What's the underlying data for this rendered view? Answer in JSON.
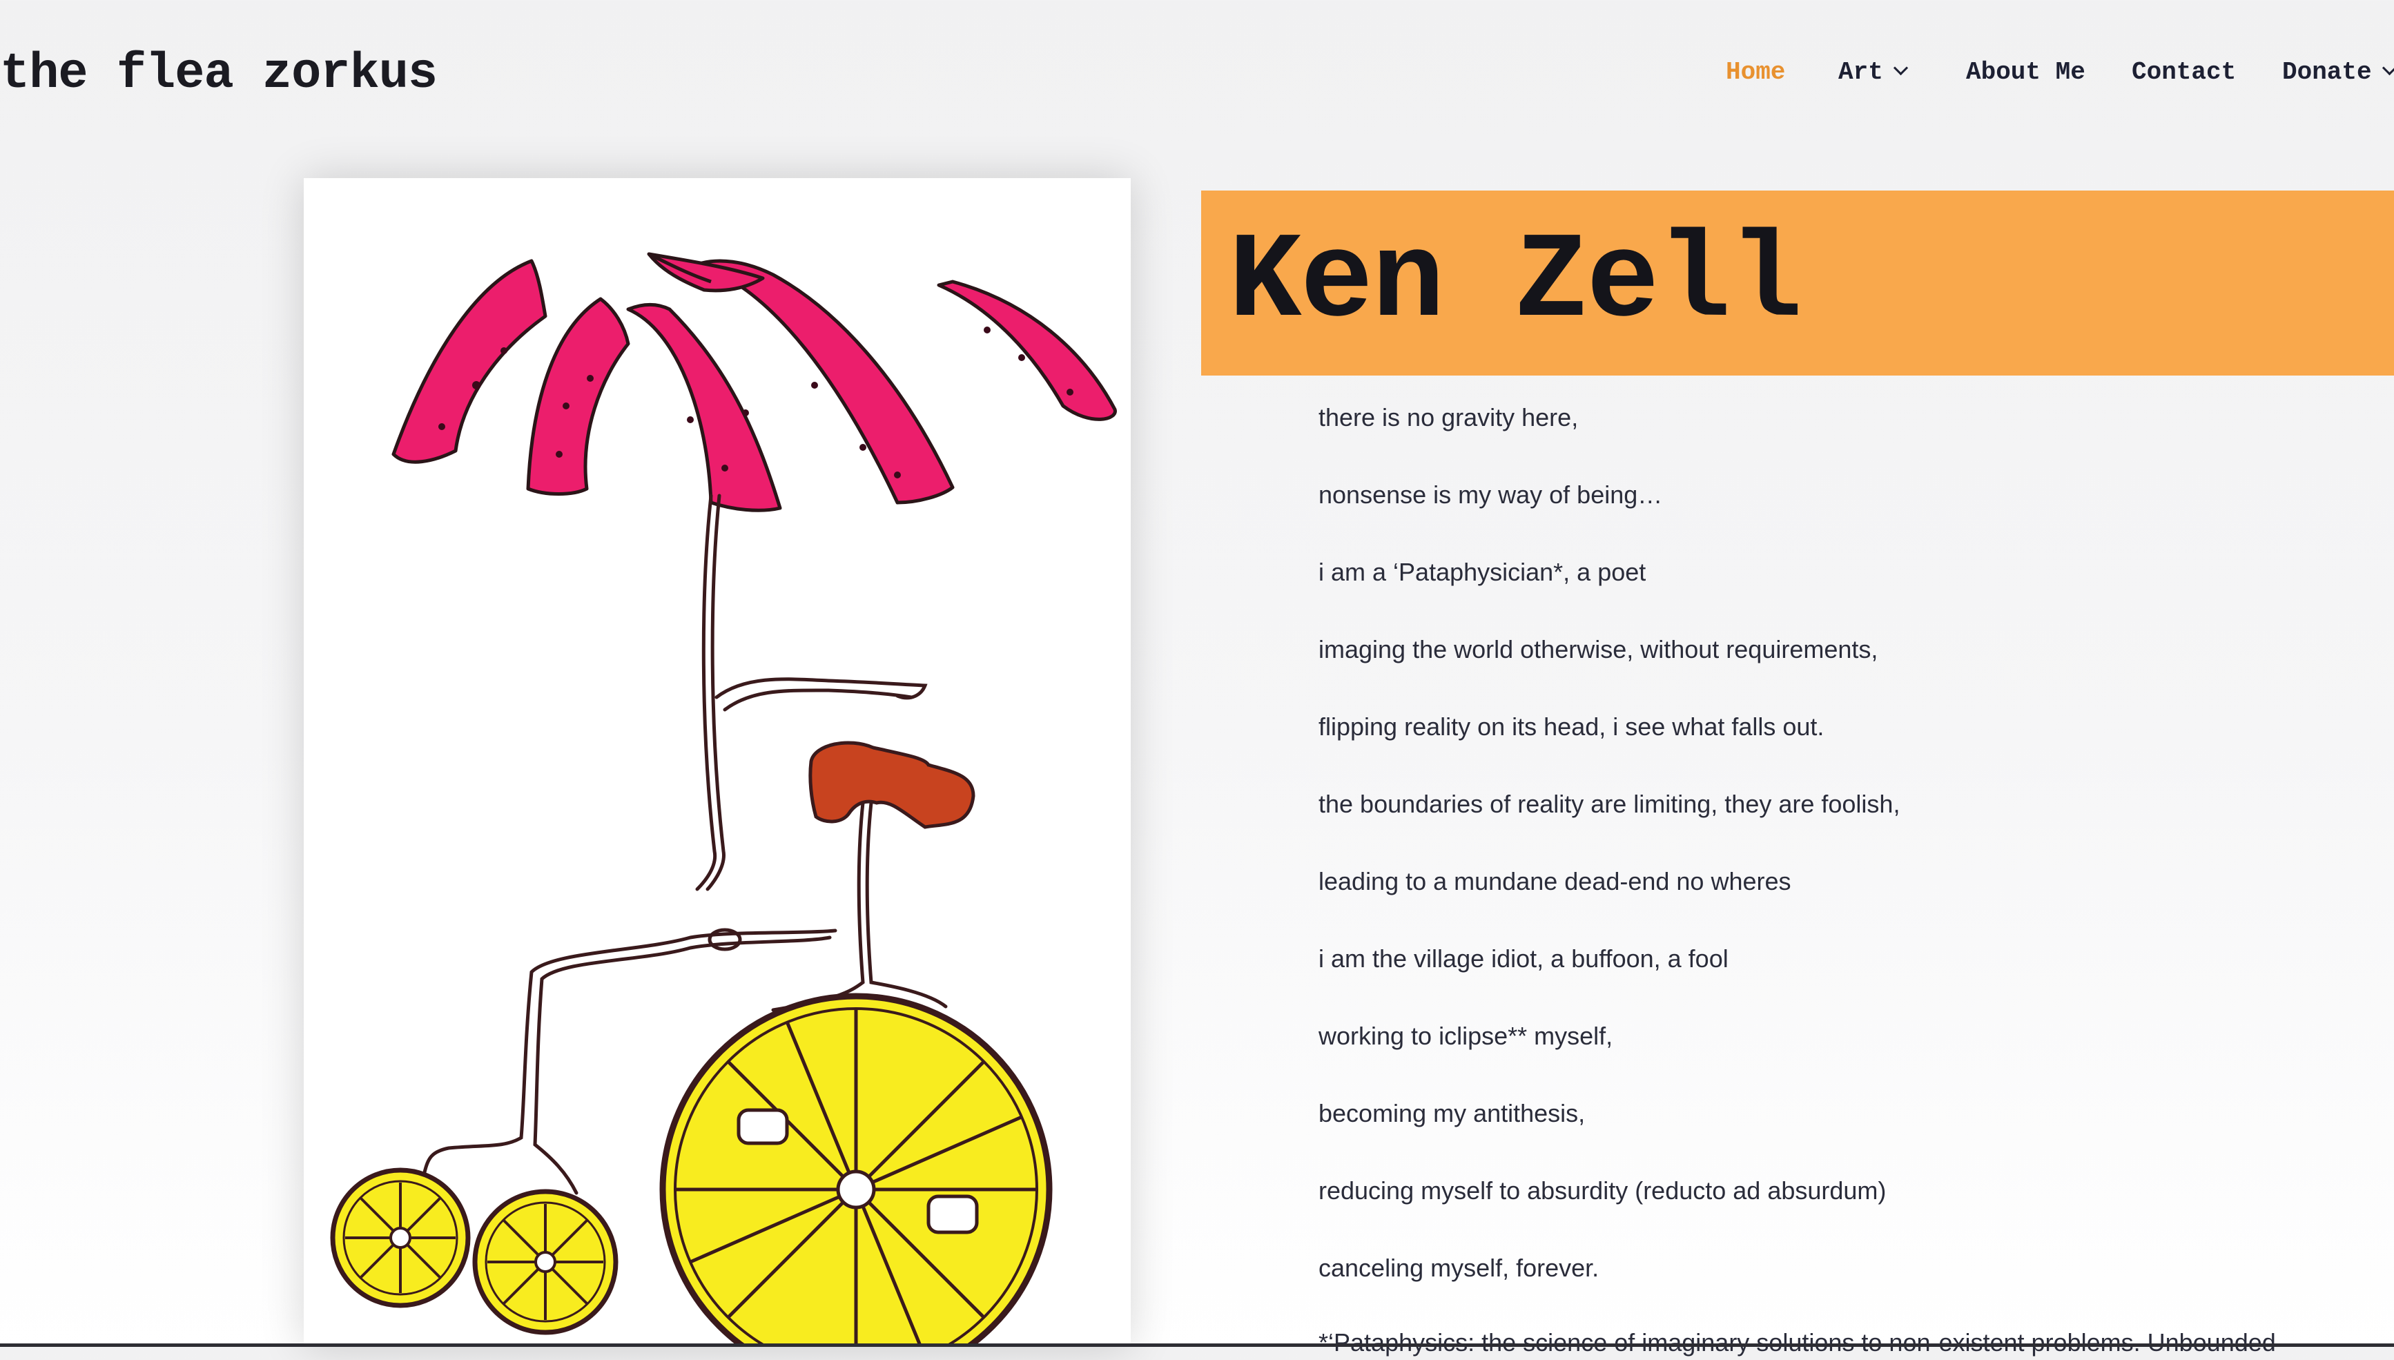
{
  "header": {
    "logo_text": "the flea zorkus",
    "nav": [
      {
        "label": "Home",
        "active": true,
        "has_dropdown": false
      },
      {
        "label": "Art",
        "active": false,
        "has_dropdown": true
      },
      {
        "label": "About Me",
        "active": false,
        "has_dropdown": false
      },
      {
        "label": "Contact",
        "active": false,
        "has_dropdown": false
      },
      {
        "label": "Donate",
        "active": false,
        "has_dropdown": true
      }
    ]
  },
  "main": {
    "title": "Ken Zell",
    "poem": [
      "there is no gravity here,",
      "nonsense is my way of being…",
      "i am a ‘Pataphysician*, a poet",
      "imaging the world otherwise, without requirements,",
      "flipping reality on its head, i see what falls out.",
      "the boundaries of reality are limiting, they are foolish,",
      "leading to a mundane dead-end no wheres",
      "i am the village idiot, a buffoon, a fool",
      "working to iclipse** myself,",
      "becoming my antithesis,",
      "reducing myself to absurdity (reducto ad absurdum)",
      "canceling myself, forever."
    ],
    "footnote": "*‘Pataphysics: the science of imaginary solutions to non-existent problems. Unbounded"
  },
  "colors": {
    "accent_orange": "#f9a84c",
    "nav_active": "#e8912f",
    "text_dark": "#1d2033",
    "umbrella_pink": "#ec1e6c",
    "wheel_yellow": "#f8ec1f",
    "seat_brown": "#c8431f"
  },
  "artwork": {
    "icon": "umbrella-bicycle-drawing"
  }
}
